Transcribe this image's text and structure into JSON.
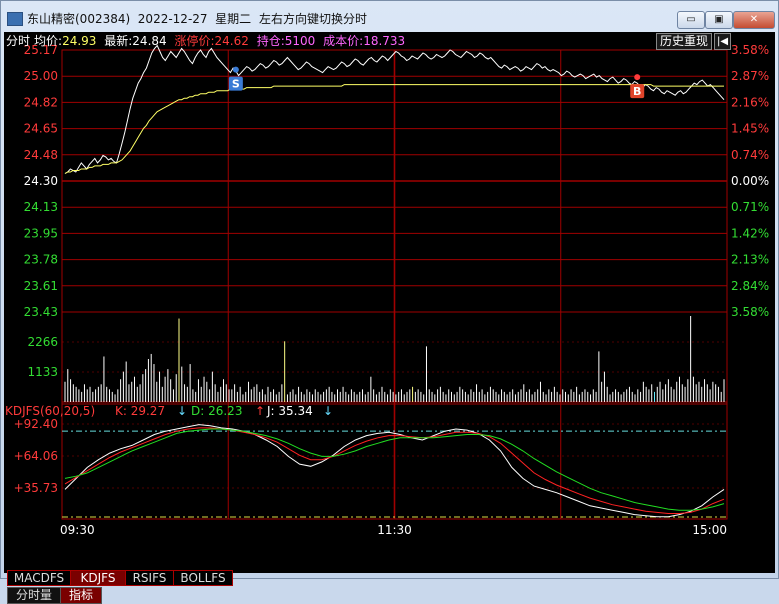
{
  "window": {
    "title": "东山精密(002384)  2022-12-27  星期二",
    "hint": "左右方向键切换分时",
    "min_label": "▭",
    "max_label": "▣",
    "close_label": "✕"
  },
  "header": {
    "mode": "分时",
    "avg_label": "均价:",
    "avg_value": "24.93",
    "last_label": "最新:",
    "last_value": "24.84",
    "limit_label": "涨停价:",
    "limit_value": "24.62",
    "pos_label": "持仓:",
    "pos_value": "5100",
    "cost_label": "成本价:",
    "cost_value": "18.733",
    "replay_label": "历史重现",
    "replay_icon": "|◀"
  },
  "colors": {
    "up": "#ff3b3b",
    "down": "#33dd33",
    "flat": "#ffffff",
    "grid": "#a00000",
    "price_line": "#ffffff",
    "avg_line": "#ffff66",
    "k_line": "#ffffff",
    "d_line": "#ff2222",
    "j_line": "#22dd22",
    "volume_up": "#ffffff",
    "volume_yellow": "#ffff88",
    "volume_cyan": "#66eeff"
  },
  "chart_data": [
    {
      "type": "line",
      "x_start": "09:30",
      "x_mid": "11:30",
      "x_end": "15:00",
      "prev_close": 24.3,
      "ylim": [
        23.43,
        25.17
      ],
      "y_ticks": [
        "25.17",
        "25.00",
        "24.82",
        "24.65",
        "24.48",
        "24.30",
        "24.13",
        "23.95",
        "23.78",
        "23.61",
        "23.43"
      ],
      "pct_ticks": [
        "3.58%",
        "2.87%",
        "2.16%",
        "1.45%",
        "0.74%",
        "0.00%",
        "0.71%",
        "1.42%",
        "2.13%",
        "2.84%",
        "3.58%"
      ],
      "markers": [
        {
          "label": "S",
          "minute": 63,
          "price": 25.04
        },
        {
          "label": "B",
          "minute": 211,
          "price": 24.99
        }
      ],
      "series": [
        {
          "role": "price",
          "values": [
            24.35,
            24.36,
            24.38,
            24.37,
            24.36,
            24.39,
            24.42,
            24.4,
            24.38,
            24.41,
            24.43,
            24.45,
            24.42,
            24.44,
            24.47,
            24.46,
            24.44,
            24.45,
            24.43,
            24.42,
            24.48,
            24.55,
            24.62,
            24.7,
            24.78,
            24.85,
            24.9,
            24.95,
            24.98,
            25.02,
            25.05,
            25.1,
            25.15,
            25.18,
            25.2,
            25.16,
            25.12,
            25.1,
            25.13,
            25.16,
            25.14,
            25.12,
            25.15,
            25.18,
            25.16,
            25.13,
            25.1,
            25.08,
            25.12,
            25.15,
            25.17,
            25.14,
            25.12,
            25.16,
            25.18,
            25.15,
            25.12,
            25.1,
            25.08,
            25.06,
            25.04,
            25.02,
            25.05,
            25.03,
            25.0,
            25.02,
            25.04,
            25.06,
            25.05,
            25.03,
            25.04,
            25.06,
            25.08,
            25.07,
            25.05,
            25.06,
            25.08,
            25.1,
            25.09,
            25.07,
            25.08,
            25.1,
            25.12,
            25.1,
            25.08,
            25.06,
            25.04,
            25.05,
            25.07,
            25.09,
            25.08,
            25.06,
            25.05,
            25.04,
            25.03,
            25.02,
            25.04,
            25.06,
            25.05,
            25.04,
            25.05,
            25.07,
            25.09,
            25.08,
            25.06,
            25.07,
            25.09,
            25.11,
            25.1,
            25.08,
            25.07,
            25.09,
            25.11,
            25.12,
            25.1,
            25.09,
            25.11,
            25.13,
            25.12,
            25.1,
            25.12,
            25.14,
            25.16,
            25.15,
            25.13,
            25.12,
            25.1,
            25.11,
            25.13,
            25.12,
            25.11,
            25.13,
            25.15,
            25.14,
            25.12,
            25.11,
            25.12,
            25.14,
            25.13,
            25.12,
            25.13,
            25.15,
            25.17,
            25.16,
            25.14,
            25.13,
            25.12,
            25.14,
            25.16,
            25.15,
            25.14,
            25.12,
            25.13,
            25.15,
            25.14,
            25.12,
            25.11,
            25.12,
            25.1,
            25.08,
            25.06,
            25.05,
            25.07,
            25.06,
            25.04,
            25.05,
            25.06,
            25.05,
            25.03,
            25.04,
            25.06,
            25.05,
            25.04,
            25.06,
            25.08,
            25.07,
            25.05,
            25.06,
            25.04,
            25.03,
            25.04,
            25.03,
            25.02,
            25.0,
            25.01,
            25.03,
            25.02,
            25.0,
            24.99,
            25.0,
            25.01,
            25.0,
            24.98,
            24.99,
            25.0,
            25.01,
            24.99,
            25.0,
            24.98,
            24.97,
            24.96,
            24.98,
            24.99,
            24.97,
            24.95,
            24.96,
            24.98,
            24.97,
            24.95,
            24.94,
            24.96,
            24.95,
            24.93,
            24.92,
            24.94,
            24.93,
            24.91,
            24.9,
            24.92,
            24.91,
            24.89,
            24.88,
            24.9,
            24.89,
            24.88,
            24.87,
            24.89,
            24.9,
            24.88,
            24.89,
            24.91,
            24.93,
            24.95,
            24.94,
            24.96,
            24.97,
            24.95,
            24.93,
            24.94,
            24.92,
            24.9,
            24.88,
            24.86,
            24.84
          ]
        },
        {
          "role": "average",
          "values": [
            24.35,
            24.36,
            24.36,
            24.37,
            24.37,
            24.37,
            24.38,
            24.38,
            24.38,
            24.39,
            24.39,
            24.4,
            24.4,
            24.4,
            24.41,
            24.41,
            24.41,
            24.42,
            24.42,
            24.42,
            24.43,
            24.44,
            24.46,
            24.48,
            24.5,
            24.53,
            24.56,
            24.59,
            24.62,
            24.65,
            24.67,
            24.7,
            24.72,
            24.74,
            24.76,
            24.77,
            24.78,
            24.79,
            24.8,
            24.81,
            24.82,
            24.83,
            24.84,
            24.84,
            24.85,
            24.85,
            24.86,
            24.86,
            24.87,
            24.87,
            24.88,
            24.88,
            24.88,
            24.89,
            24.89,
            24.89,
            24.9,
            24.9,
            24.9,
            24.9,
            24.9,
            24.91,
            24.91,
            24.91,
            24.91,
            24.91,
            24.91,
            24.92,
            24.92,
            24.92,
            24.92,
            24.92,
            24.92,
            24.92,
            24.92,
            24.92,
            24.92,
            24.93,
            24.93,
            24.93,
            24.93,
            24.93,
            24.93,
            24.93,
            24.93,
            24.93,
            24.93,
            24.93,
            24.93,
            24.93,
            24.93,
            24.93,
            24.93,
            24.93,
            24.93,
            24.93,
            24.93,
            24.93,
            24.93,
            24.93,
            24.93,
            24.93,
            24.93,
            24.94,
            24.94,
            24.94,
            24.94,
            24.94,
            24.94,
            24.94,
            24.94,
            24.94,
            24.94,
            24.94,
            24.94,
            24.94,
            24.94,
            24.94,
            24.94,
            24.94,
            24.94,
            24.94,
            24.94,
            24.94,
            24.94,
            24.94,
            24.94,
            24.94,
            24.94,
            24.94,
            24.94,
            24.94,
            24.94,
            24.94,
            24.94,
            24.94,
            24.94,
            24.94,
            24.94,
            24.94,
            24.94,
            24.94,
            24.94,
            24.94,
            24.94,
            24.94,
            24.94,
            24.94,
            24.94,
            24.94,
            24.94,
            24.94,
            24.94,
            24.94,
            24.94,
            24.94,
            24.94,
            24.94,
            24.94,
            24.94,
            24.94,
            24.94,
            24.94,
            24.94,
            24.94,
            24.94,
            24.94,
            24.94,
            24.94,
            24.94,
            24.94,
            24.94,
            24.94,
            24.94,
            24.94,
            24.94,
            24.94,
            24.94,
            24.94,
            24.94,
            24.94,
            24.94,
            24.94,
            24.94,
            24.94,
            24.94,
            24.94,
            24.94,
            24.94,
            24.94,
            24.94,
            24.94,
            24.94,
            24.94,
            24.94,
            24.94,
            24.94,
            24.94,
            24.94,
            24.94,
            24.94,
            24.94,
            24.94,
            24.94,
            24.94,
            24.94,
            24.94,
            24.94,
            24.94,
            24.94,
            24.94,
            24.94,
            24.94,
            24.94,
            24.94,
            24.94,
            24.94,
            24.93,
            24.93,
            24.93,
            24.93,
            24.93,
            24.93,
            24.93,
            24.93,
            24.93,
            24.93,
            24.93,
            24.93,
            24.93,
            24.93,
            24.93,
            24.93,
            24.93,
            24.93,
            24.93,
            24.93,
            24.93,
            24.93,
            24.93,
            24.93,
            24.93,
            24.93,
            24.93
          ]
        }
      ]
    },
    {
      "type": "bar",
      "y_ticks": [
        "2266",
        "1133"
      ],
      "ylim": [
        0,
        3400
      ],
      "values": [
        800,
        1300,
        900,
        700,
        600,
        500,
        400,
        700,
        500,
        600,
        400,
        500,
        600,
        700,
        1800,
        600,
        500,
        400,
        300,
        500,
        900,
        1200,
        1600,
        700,
        800,
        1000,
        600,
        700,
        1100,
        1300,
        1700,
        1900,
        1500,
        800,
        1200,
        600,
        1000,
        1300,
        900,
        500,
        1100,
        3300,
        1400,
        700,
        600,
        1500,
        500,
        400,
        900,
        600,
        1000,
        800,
        500,
        1200,
        700,
        400,
        600,
        900,
        700,
        500,
        500,
        700,
        400,
        600,
        300,
        400,
        800,
        500,
        600,
        700,
        400,
        500,
        300,
        600,
        400,
        500,
        300,
        400,
        700,
        2400,
        300,
        400,
        500,
        300,
        600,
        400,
        300,
        500,
        400,
        300,
        500,
        400,
        300,
        400,
        500,
        600,
        400,
        300,
        500,
        400,
        600,
        400,
        300,
        500,
        400,
        300,
        400,
        500,
        300,
        400,
        1000,
        500,
        300,
        400,
        600,
        400,
        300,
        500,
        400,
        300,
        400,
        500,
        300,
        400,
        500,
        600,
        400,
        500,
        400,
        300,
        2200,
        500,
        400,
        300,
        500,
        600,
        400,
        300,
        500,
        400,
        300,
        400,
        600,
        500,
        400,
        300,
        500,
        400,
        700,
        400,
        500,
        300,
        400,
        600,
        500,
        400,
        300,
        500,
        400,
        300,
        400,
        500,
        300,
        400,
        500,
        700,
        400,
        500,
        300,
        400,
        500,
        800,
        400,
        300,
        500,
        400,
        600,
        400,
        300,
        500,
        400,
        300,
        500,
        400,
        600,
        300,
        400,
        500,
        400,
        300,
        500,
        400,
        2000,
        800,
        1200,
        600,
        300,
        400,
        500,
        400,
        300,
        400,
        500,
        600,
        400,
        300,
        500,
        400,
        800,
        600,
        500,
        700,
        400,
        600,
        800,
        500,
        700,
        900,
        600,
        500,
        800,
        1000,
        700,
        600,
        900,
        3400,
        1000,
        700,
        800,
        600,
        900,
        700,
        500,
        800,
        700,
        600,
        400,
        900
      ],
      "highlight": [
        {
          "index": 41,
          "color": "yellow"
        },
        {
          "index": 79,
          "color": "yellow"
        },
        {
          "index": 125,
          "color": "yellow"
        },
        {
          "index": 212,
          "color": "cyan"
        },
        {
          "index": 269,
          "color": "yellow"
        }
      ]
    },
    {
      "type": "line",
      "title": "KDJFS(60,20,5)",
      "k_label": "K: 29.27",
      "d_label": "D: 26.23",
      "j_label": "J: 35.34",
      "k_arrow": "↓",
      "d_arrow": "↑",
      "j_arrow": "↓",
      "y_ticks": [
        "+92.40",
        "+64.06",
        "+35.73"
      ],
      "ylim": [
        8,
        100
      ],
      "level_high": 88,
      "level_low": 8,
      "series": [
        {
          "name": "K",
          "values": [
            35,
            45,
            55,
            62,
            68,
            72,
            75,
            80,
            85,
            88,
            90,
            92,
            94,
            93,
            91,
            90,
            88,
            85,
            80,
            74,
            65,
            58,
            56,
            60,
            66,
            74,
            80,
            84,
            86,
            87,
            85,
            82,
            80,
            84,
            88,
            90,
            89,
            86,
            80,
            70,
            55,
            45,
            38,
            35,
            32,
            28,
            24,
            20,
            18,
            16,
            14,
            12,
            11,
            10,
            10,
            12,
            15,
            20,
            28,
            35
          ]
        },
        {
          "name": "D",
          "values": [
            40,
            46,
            52,
            58,
            64,
            69,
            73,
            77,
            81,
            85,
            88,
            90,
            91,
            91,
            90,
            89,
            87,
            85,
            82,
            78,
            72,
            66,
            62,
            62,
            65,
            70,
            75,
            79,
            82,
            84,
            84,
            83,
            82,
            83,
            85,
            87,
            87,
            86,
            83,
            77,
            68,
            59,
            50,
            44,
            39,
            35,
            31,
            27,
            24,
            21,
            19,
            17,
            15,
            14,
            13,
            13,
            14,
            17,
            22,
            26
          ]
        },
        {
          "name": "J",
          "values": [
            45,
            47,
            50,
            55,
            60,
            65,
            70,
            74,
            78,
            82,
            86,
            88,
            89,
            90,
            90,
            89,
            88,
            86,
            84,
            81,
            77,
            72,
            68,
            65,
            65,
            67,
            70,
            74,
            77,
            80,
            82,
            82,
            82,
            82,
            83,
            84,
            85,
            85,
            84,
            81,
            76,
            70,
            63,
            57,
            51,
            46,
            41,
            36,
            32,
            29,
            26,
            23,
            21,
            19,
            17,
            16,
            16,
            17,
            19,
            22
          ]
        }
      ]
    }
  ],
  "axis": {
    "x_labels": [
      "09:30",
      "11:30",
      "15:00"
    ]
  },
  "tabs": [
    {
      "label": "MACDFS",
      "active": false
    },
    {
      "label": "KDJFS",
      "active": true
    },
    {
      "label": "RSIFS",
      "active": false
    },
    {
      "label": "BOLLFS",
      "active": false
    }
  ],
  "bottom_tabs": [
    {
      "label": "分时量"
    },
    {
      "label": "指标"
    }
  ]
}
